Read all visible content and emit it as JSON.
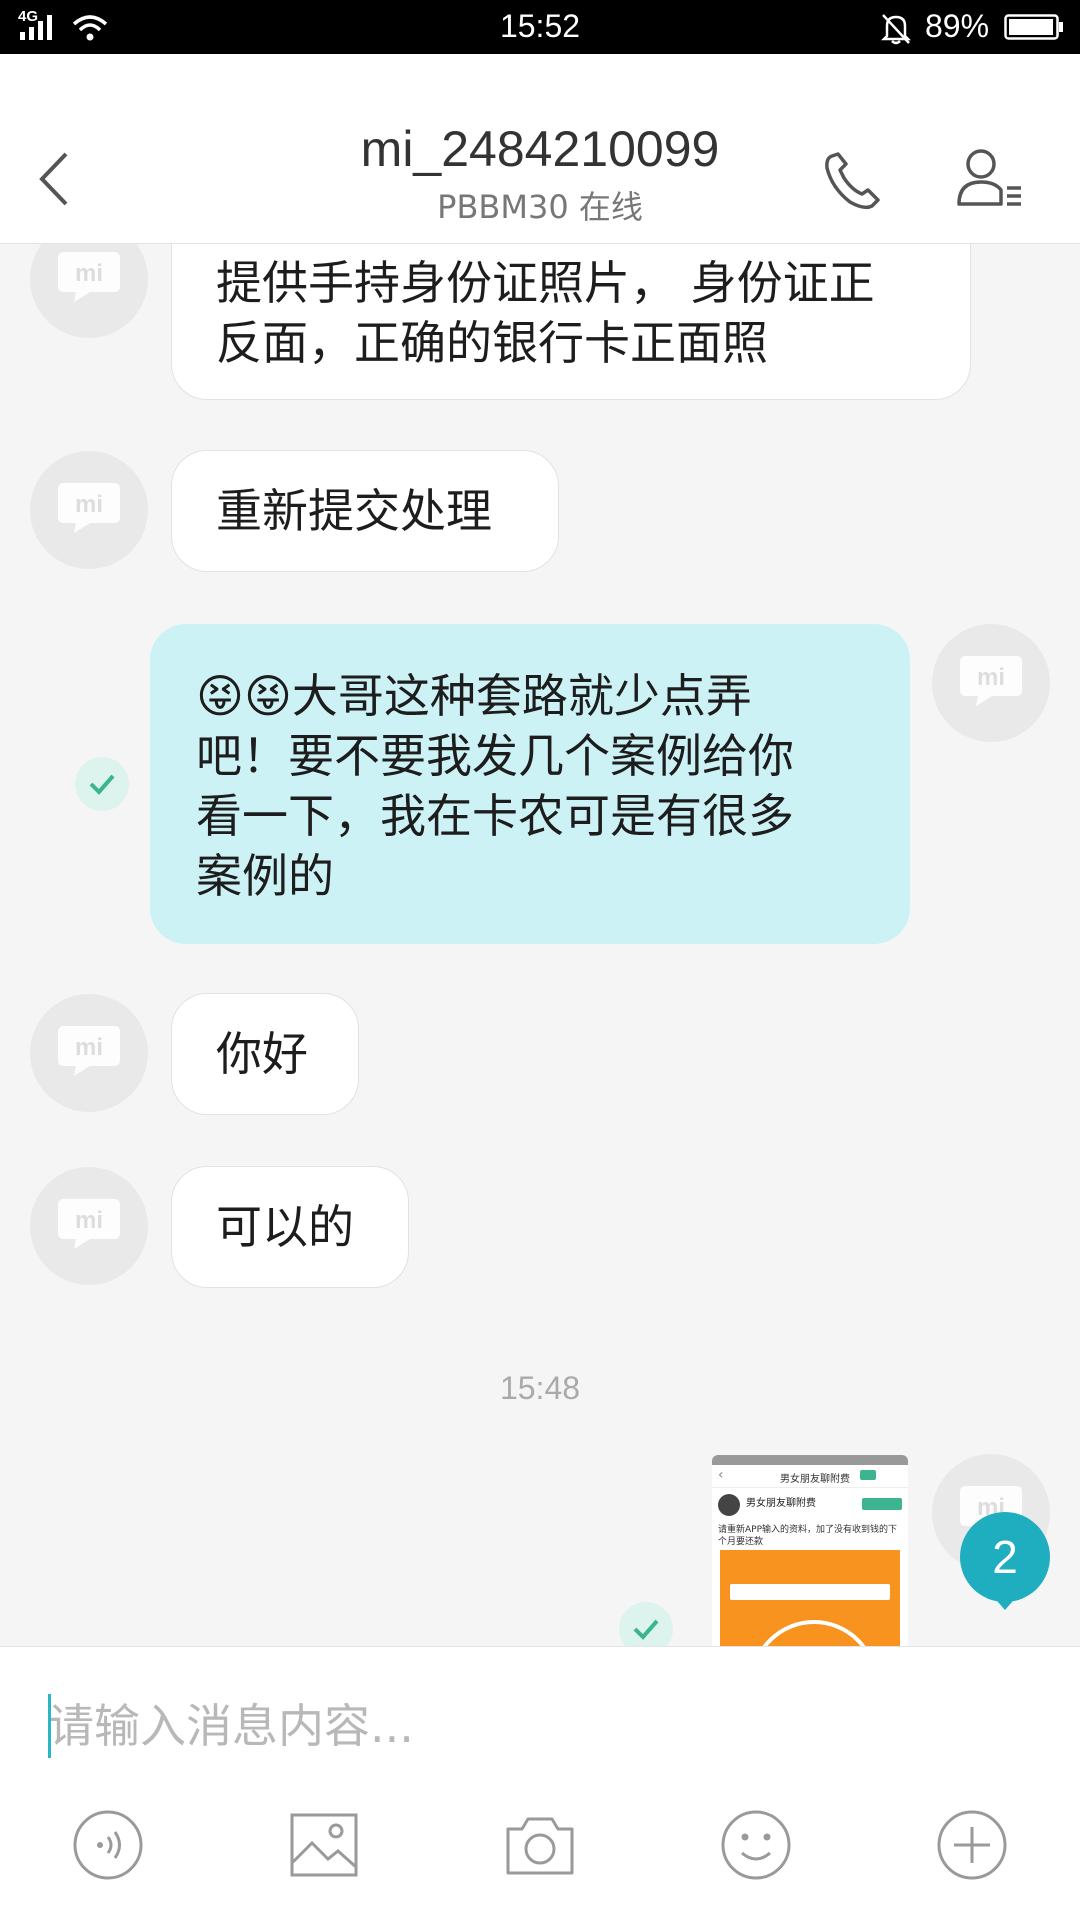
{
  "status_bar": {
    "network": "4G",
    "time": "15:52",
    "battery": "89%"
  },
  "header": {
    "title": "mi_2484210099",
    "subtitle": "PBBM30 在线"
  },
  "messages": [
    {
      "side": "left",
      "text_line1": "提供手持身份证照片， 身份证正",
      "text_line2": "反面，正确的银行卡正面照"
    },
    {
      "side": "left",
      "text": "重新提交处理"
    },
    {
      "side": "right",
      "emoji": "😝😝",
      "line1": "大哥这种套路就少点弄",
      "line2": "吧！要不要我发几个案例给你",
      "line3": "看一下，我在卡农可是有很多",
      "line4": "案例的"
    },
    {
      "side": "left",
      "text": "你好"
    },
    {
      "side": "left",
      "text": "可以的"
    }
  ],
  "timestamp": "15:48",
  "image_message": {
    "thumb_title": "男女朋友聊附费",
    "thumb_name": "男女朋友聊附费",
    "thumb_line": "请重新APP输入的资料，加了没有收到钱的下个月要还款"
  },
  "unread_badge": "2",
  "input": {
    "placeholder": "请输入消息内容..."
  },
  "toolbar_icons": [
    "voice-icon",
    "image-icon",
    "camera-icon",
    "emoji-icon",
    "plus-icon"
  ]
}
